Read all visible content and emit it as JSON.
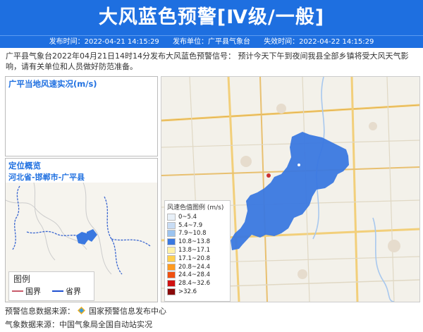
{
  "header": {
    "title": "大风蓝色预警[Ⅳ级/一般]",
    "publish_time": "发布时间：2022-04-21 14:15:29",
    "publisher": "发布单位：广平县气象台",
    "expire_time": "失效时间：2022-04-22 14:15:29"
  },
  "description": "广平县气象台2022年04月21日14时14分发布大风蓝色预警信号：  预计今天下午到夜间我县全部乡镇将受大风天气影响，请有关单位和人员做好防范准备。",
  "wind_panel": {
    "title": "广平当地风速实况(m/s)"
  },
  "location_panel": {
    "title": "定位概览",
    "region": "河北省-邯郸市-广平县",
    "legend": {
      "title": "图例",
      "items": [
        {
          "label": "国界",
          "color": "#c85a6a"
        },
        {
          "label": "省界",
          "color": "#1e50d0"
        }
      ]
    }
  },
  "map_legend": {
    "title": "风速色值图例 (m/s)",
    "items": [
      {
        "label": "0~5.4",
        "color": "#e8f0f8"
      },
      {
        "label": "5.4~7.9",
        "color": "#c8dcf4"
      },
      {
        "label": "7.9~10.8",
        "color": "#9cc4f0"
      },
      {
        "label": "10.8~13.8",
        "color": "#3a78e0"
      },
      {
        "label": "13.8~17.1",
        "color": "#fff2a8"
      },
      {
        "label": "17.1~20.8",
        "color": "#ffd050"
      },
      {
        "label": "20.8~24.4",
        "color": "#ff9a20"
      },
      {
        "label": "24.4~28.4",
        "color": "#f05010"
      },
      {
        "label": "28.4~32.6",
        "color": "#d01010"
      },
      {
        "label": ">32.6",
        "color": "#8a0a0a"
      }
    ]
  },
  "footer": {
    "warning_source": "预警信息数据来源：",
    "warning_source_name": "国家预警信息发布中心",
    "weather_source": "气象数据来源：中国气象局全国自动站实况"
  },
  "colors": {
    "accent": "#1e6fe0",
    "warning_area": "#3a78e0"
  }
}
